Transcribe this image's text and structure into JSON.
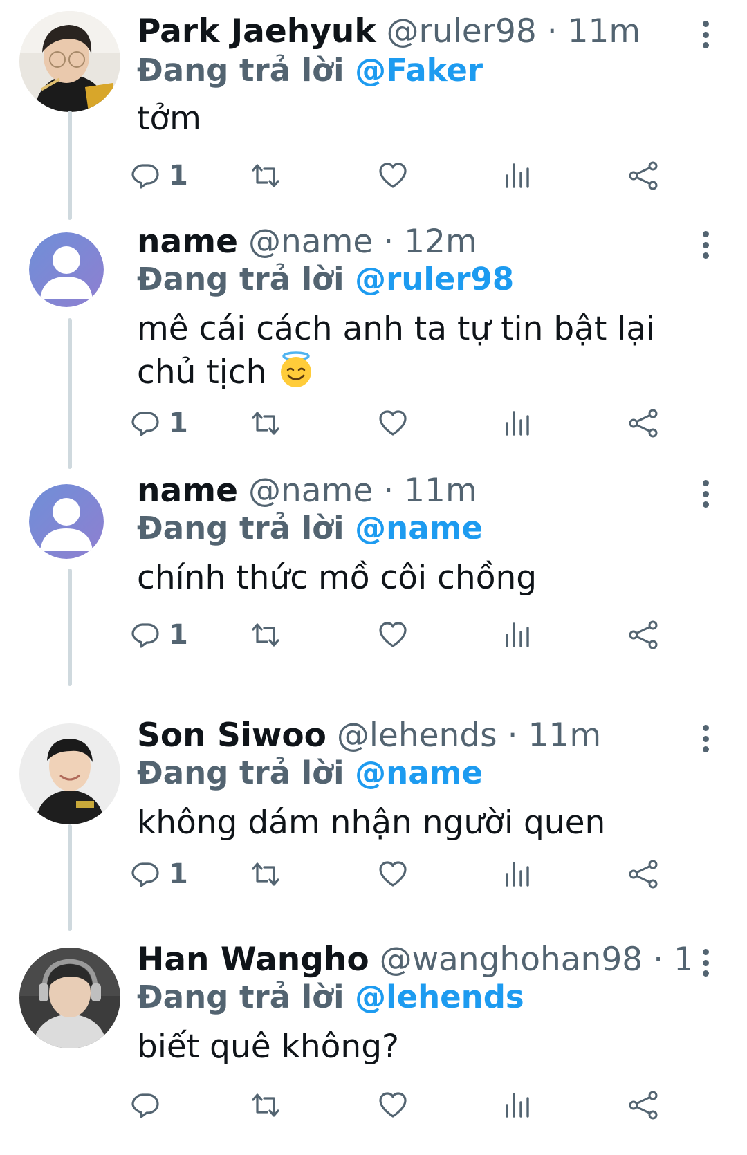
{
  "tweets": [
    {
      "name": "Park Jaehyuk",
      "handle": "@ruler98",
      "dot": "·",
      "time": "11m",
      "reply_prefix": "Đang trả lời",
      "reply_to": "@Faker",
      "text": "tởm",
      "reply_count": "1"
    },
    {
      "name": "name",
      "handle": "@name",
      "dot": "·",
      "time": "12m",
      "reply_prefix": "Đang trả lời",
      "reply_to": "@ruler98",
      "text": "mê cái cách anh ta tự tin bật lại chủ tịch",
      "emoji": "smiling-face-with-halo",
      "reply_count": "1"
    },
    {
      "name": "name",
      "handle": "@name",
      "dot": "·",
      "time": "11m",
      "reply_prefix": "Đang trả lời",
      "reply_to": "@name",
      "text": "chính thức mồ côi chồng",
      "reply_count": "1"
    },
    {
      "name": "Son Siwoo",
      "handle": "@lehends",
      "dot": "·",
      "time": "11m",
      "reply_prefix": "Đang trả lời",
      "reply_to": "@name",
      "text": "không dám nhận người quen",
      "reply_count": "1"
    },
    {
      "name": "Han Wangho",
      "handle": "@wanghohan98",
      "dot": "·",
      "time": "1...",
      "reply_prefix": "Đang trả lời",
      "reply_to": "@lehends",
      "text": "biết quê không?",
      "reply_count": ""
    }
  ],
  "colors": {
    "accent": "#1d9bf0",
    "muted": "#536471",
    "thread": "#cfd9de"
  },
  "icons": [
    "reply-icon",
    "retweet-icon",
    "like-icon",
    "views-icon",
    "share-icon",
    "more-icon"
  ]
}
